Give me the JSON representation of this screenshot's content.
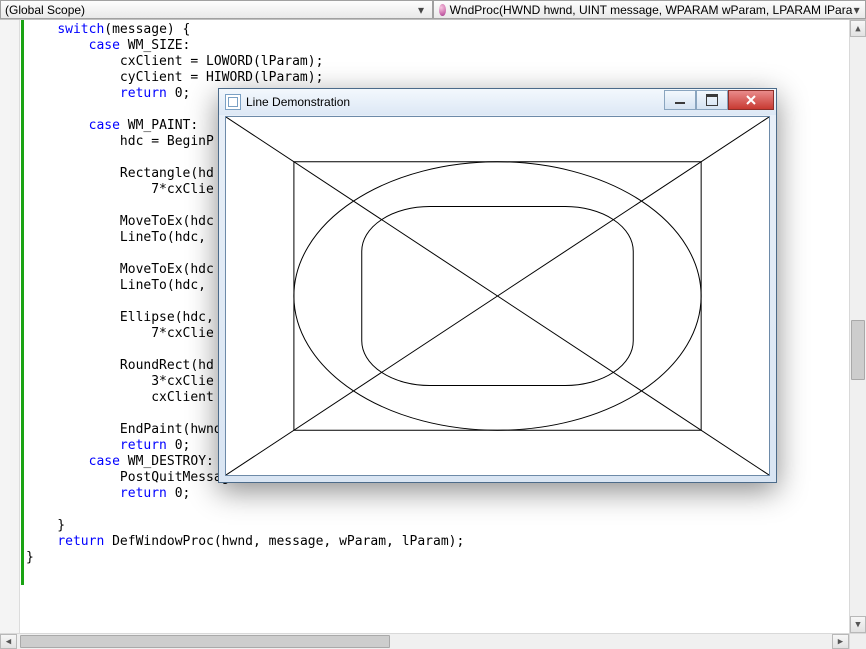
{
  "navbar": {
    "scope_label": "(Global Scope)",
    "function_label": "WndProc(HWND hwnd, UINT message, WPARAM wParam, LPARAM lPara"
  },
  "popup": {
    "title": "Line Demonstration"
  },
  "code": {
    "l01_a": "    ",
    "l01_kw": "switch",
    "l01_b": "(message) {",
    "l02_a": "        ",
    "l02_kw": "case",
    "l02_b": " WM_SIZE:",
    "l03": "            cxClient = LOWORD(lParam);",
    "l04": "            cyClient = HIWORD(lParam);",
    "l05_a": "            ",
    "l05_kw": "return",
    "l05_b": " 0;",
    "l06": "",
    "l07_a": "        ",
    "l07_kw": "case",
    "l07_b": " WM_PAINT:",
    "l08": "            hdc = BeginP",
    "l09": "",
    "l10": "            Rectangle(hd",
    "l11": "                7*cxClie",
    "l12": "",
    "l13": "            MoveToEx(hdc",
    "l14": "            LineTo(hdc, ",
    "l15": "",
    "l16": "            MoveToEx(hdc",
    "l17": "            LineTo(hdc, ",
    "l18": "",
    "l19": "            Ellipse(hdc,",
    "l20": "                7*cxClie",
    "l21": "",
    "l22": "            RoundRect(hd",
    "l23": "                3*cxClie",
    "l24": "                cxClient",
    "l25": "",
    "l26": "            EndPaint(hwnd, &ps);",
    "l27_a": "            ",
    "l27_kw": "return",
    "l27_b": " 0;",
    "l28_a": "        ",
    "l28_kw": "case",
    "l28_b": " WM_DESTROY:",
    "l29": "            PostQuitMessage(0);",
    "l30_a": "            ",
    "l30_kw": "return",
    "l30_b": " 0;",
    "l31": "",
    "l32": "    }",
    "l33_a": "    ",
    "l33_kw": "return",
    "l33_b": " DefWindowProc(hwnd, message, wParam, lParam);",
    "l34": "}"
  }
}
